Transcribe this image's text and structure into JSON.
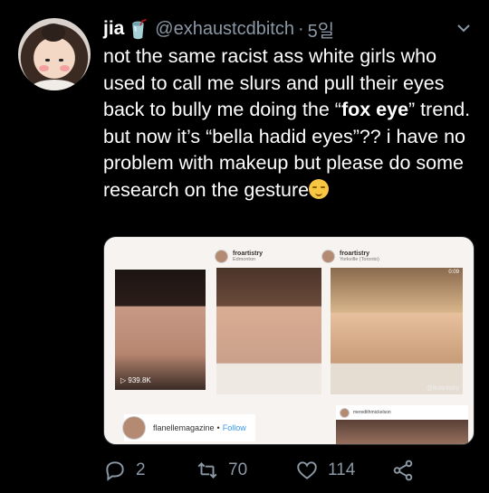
{
  "tweet": {
    "author_name": "jia",
    "author_emoji": "🥤",
    "handle": "@exhaustcdbitch",
    "separator": "·",
    "time": "5일",
    "text_1": "not the same racist ass white girls who used to call me slurs and pull their eyes back to bully me doing the “",
    "text_bold": "fox eye",
    "text_2": "” trend. but now it’s “bella hadid eyes”?? i have no problem with makeup but please do some research on the gesture"
  },
  "media": {
    "left_views": "▷ 939.8K",
    "mid_user": "froartistry",
    "mid_location": "Edmonton",
    "right_user": "froartistry",
    "right_location": "Yorkville (Toronto)",
    "right_time": "0:09",
    "watermark": "@froartistry",
    "brand_name": "flanellemagazine",
    "brand_separator": "•",
    "brand_follow": "Follow",
    "bottom_right_user": "meredithmickelson"
  },
  "actions": {
    "replies": "2",
    "retweets": "70",
    "likes": "114"
  },
  "icons": {
    "reply": "reply-icon",
    "retweet": "retweet-icon",
    "like": "heart-icon",
    "share": "share-icon",
    "more": "chevron-down-icon"
  },
  "colors": {
    "background": "#000000",
    "muted": "#8b98a5",
    "follow_blue": "#3897f0"
  }
}
